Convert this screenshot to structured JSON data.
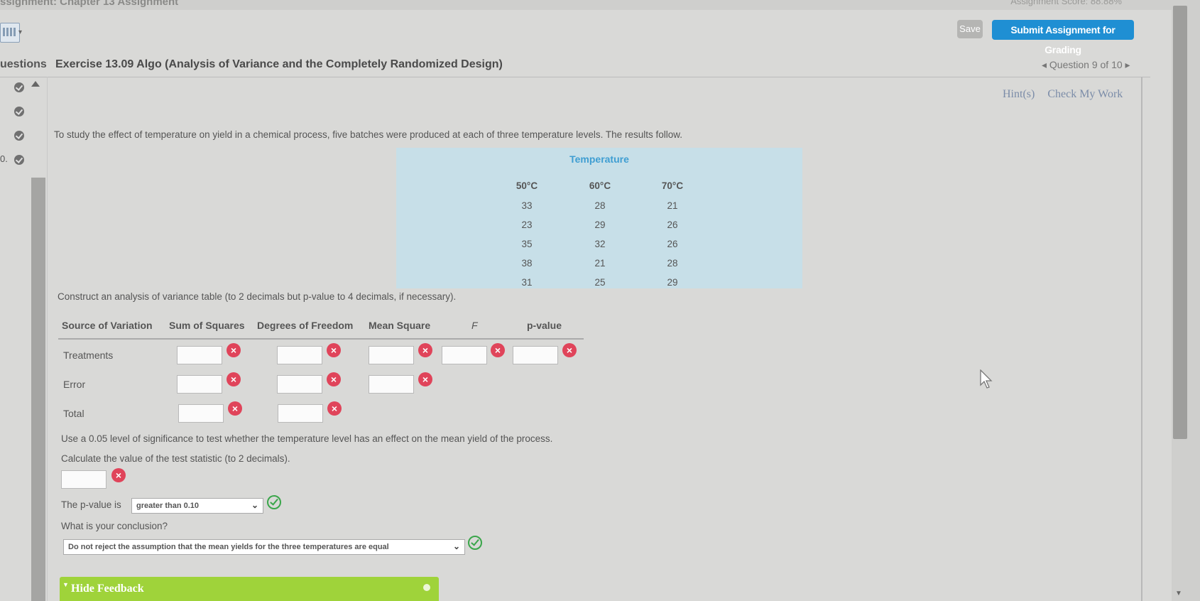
{
  "top": {
    "assignment_title": "ssignment: Chapter 13 Assignment",
    "score_text": "Assignment Score: 88.88%"
  },
  "toolbar": {
    "save_label": "Save",
    "submit_label": "Submit Assignment for Grading"
  },
  "header": {
    "questions_tab": "uestions",
    "exercise_title": "Exercise 13.09 Algo (Analysis of Variance and the Completely Randomized Design)",
    "nav": "◂ Question 9 of 10 ▸"
  },
  "sidebar": {
    "partial_number": "0."
  },
  "hints": {
    "hint": "Hint(s)",
    "check": "Check My Work"
  },
  "question": {
    "intro": "To study the effect of temperature on yield in a chemical process, five batches were produced at each of three temperature levels. The results follow.",
    "table_title": "Temperature",
    "columns": [
      {
        "header": "50°C",
        "values": [
          "33",
          "23",
          "35",
          "38",
          "31"
        ]
      },
      {
        "header": "60°C",
        "values": [
          "28",
          "29",
          "32",
          "21",
          "25"
        ]
      },
      {
        "header": "70°C",
        "values": [
          "21",
          "26",
          "26",
          "28",
          "29"
        ]
      }
    ],
    "instruction": "Construct an analysis of variance table (to 2 decimals but p-value to 4 decimals, if necessary)."
  },
  "anova": {
    "headers": [
      "Source of Variation",
      "Sum of Squares",
      "Degrees of Freedom",
      "Mean Square",
      "F",
      "p-value"
    ],
    "rows": [
      "Treatments",
      "Error",
      "Total"
    ]
  },
  "part2": {
    "significance_text": "Use a 0.05 level of significance to test whether the temperature level has an effect on the mean yield of the process.",
    "calc_text": "Calculate the value of the test statistic (to 2 decimals).",
    "pvalue_label": "The p-value is",
    "pvalue_selected": "greater than 0.10",
    "conclusion_question": "What is your conclusion?",
    "conclusion_selected": "Do not reject the assumption that the mean yields for the three temperatures are equal"
  },
  "feedback": {
    "label": "Hide Feedback"
  },
  "colors": {
    "accent": "#1f8fd3",
    "error": "#e0445a",
    "ok": "#3aa64a",
    "table_bg": "#c7dfe8",
    "feedback_bg": "#9fd33a"
  }
}
